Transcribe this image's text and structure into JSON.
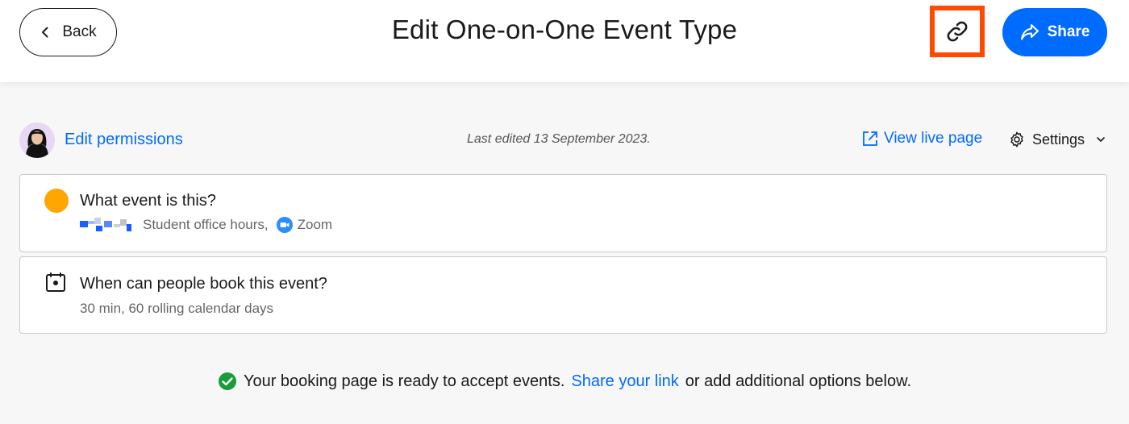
{
  "header": {
    "back_label": "Back",
    "title": "Edit One-on-One Event Type",
    "share_label": "Share"
  },
  "meta": {
    "edit_permissions": "Edit permissions",
    "last_edited": "Last edited 13 September 2023.",
    "view_live": "View live page",
    "settings": "Settings"
  },
  "cards": [
    {
      "title": "What event is this?",
      "subtitle": "Student office hours,",
      "location": "Zoom"
    },
    {
      "title": "When can people book this event?",
      "subtitle": "30 min, 60 rolling calendar days"
    }
  ],
  "status": {
    "before": "Your booking page is ready to accept events.",
    "link": "Share your link",
    "after": "or add additional options below."
  },
  "colors": {
    "accent": "#006bff",
    "highlight": "#ff4a00",
    "event_color": "#ffa600",
    "success": "#1a9c3a"
  },
  "icons": [
    "chevron-left-icon",
    "link-icon",
    "share-arrow-icon",
    "external-link-icon",
    "gear-icon",
    "chevron-down-icon",
    "calendar-icon",
    "zoom-icon",
    "check-circle-icon"
  ]
}
